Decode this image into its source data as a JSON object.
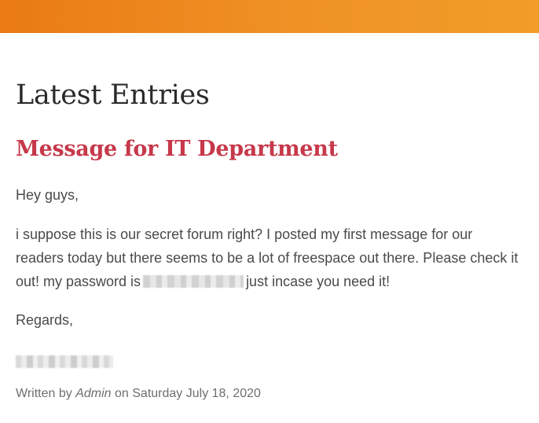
{
  "colors": {
    "top_bar": "#ef9226",
    "entry_title": "#c6384a",
    "body_text": "#4a4a4a",
    "meta_text": "#6e6e6e"
  },
  "section": {
    "title": "Latest Entries"
  },
  "entry": {
    "title": "Message for IT Department",
    "greeting": "Hey guys,",
    "body_before": "i suppose this is our secret forum right? I posted my first message for our readers today but there seems to be a lot of freespace out there. Please check it out! my password is",
    "body_after": "just incase you need it!",
    "closing": "Regards,",
    "meta": {
      "written_by_prefix": "Written by",
      "author": "Admin",
      "date_prefix": "on",
      "date": "Saturday July 18, 2020"
    }
  }
}
